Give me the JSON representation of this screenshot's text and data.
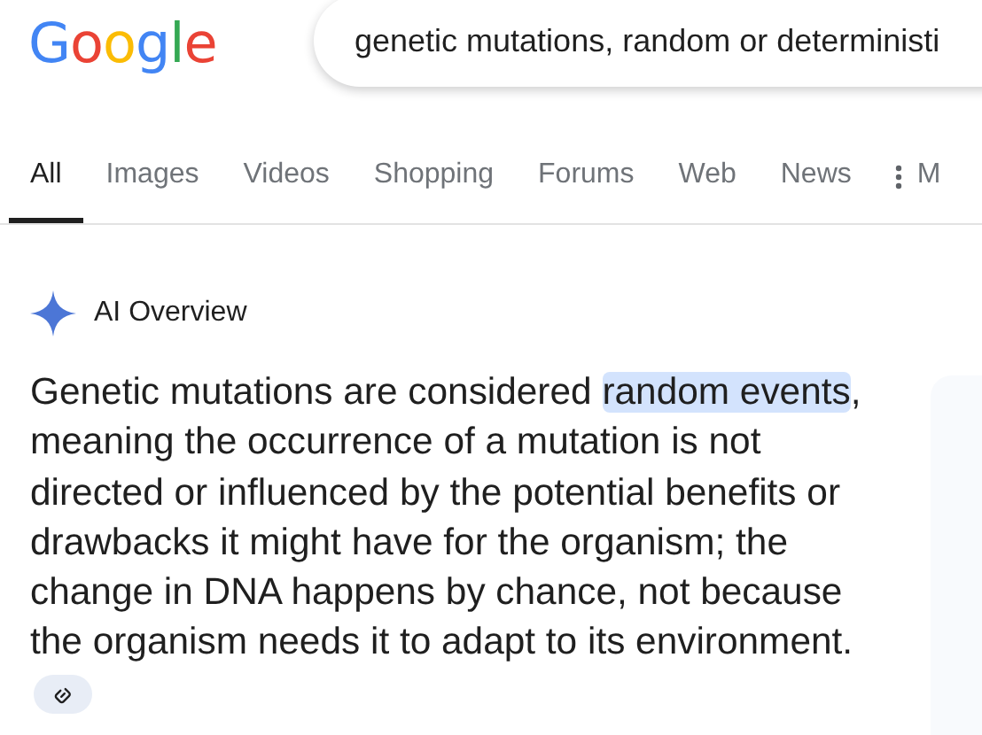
{
  "logo": "Google",
  "search": {
    "value": "genetic mutations, random or deterministi"
  },
  "tabs": [
    {
      "label": "All",
      "selected": true
    },
    {
      "label": "Images",
      "selected": false
    },
    {
      "label": "Videos",
      "selected": false
    },
    {
      "label": "Shopping",
      "selected": false
    },
    {
      "label": "Forums",
      "selected": false
    },
    {
      "label": "Web",
      "selected": false
    },
    {
      "label": "News",
      "selected": false
    },
    {
      "label": "M",
      "selected": false,
      "kind": "more"
    }
  ],
  "ai_overview": {
    "title": "AI Overview",
    "paragraph": [
      {
        "text": "Genetic mutations are considered ",
        "highlighted": false
      },
      {
        "text": "random events",
        "highlighted": true
      },
      {
        "text": ", meaning the occurrence of a mutation is not directed or influenced by the potential benefits or drawbacks it might have for the organism; the change in DNA happens by chance, not because the organism needs it to adapt to its environment.",
        "highlighted": false
      }
    ]
  }
}
